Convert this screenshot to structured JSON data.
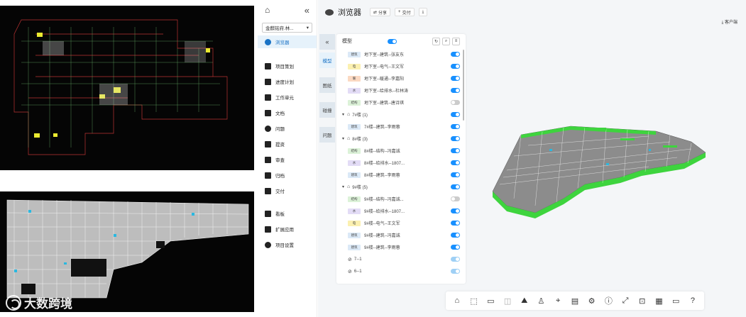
{
  "sidebar": {
    "project": "金麒铭府.林...",
    "items": [
      {
        "label": "浏览器",
        "icon": "eye-icon"
      },
      {
        "label": "项目策划",
        "icon": "flag-icon"
      },
      {
        "label": "进度计划",
        "icon": "schedule-icon"
      },
      {
        "label": "工作单元",
        "icon": "cube-icon"
      },
      {
        "label": "文档",
        "icon": "folder-icon"
      },
      {
        "label": "问题",
        "icon": "question-icon"
      },
      {
        "label": "提资",
        "icon": "file-icon"
      },
      {
        "label": "审查",
        "icon": "review-icon"
      },
      {
        "label": "归档",
        "icon": "archive-icon"
      },
      {
        "label": "交付",
        "icon": "delivery-icon"
      },
      {
        "label": "看板",
        "icon": "board-icon"
      },
      {
        "label": "扩展应用",
        "icon": "apps-icon"
      },
      {
        "label": "项目设置",
        "icon": "gear-icon"
      }
    ]
  },
  "header": {
    "title": "浏览器",
    "share": "分享",
    "deliver": "交付",
    "client": "客户端"
  },
  "tabs": [
    "模型",
    "图纸",
    "碰撞",
    "问题"
  ],
  "panel": {
    "label": "模型"
  },
  "rows": [
    {
      "type": "item",
      "tag": "建筑",
      "tagColor": "#dbe9f7",
      "text": "地下室--建筑--张友东",
      "on": true
    },
    {
      "type": "item",
      "tag": "电",
      "tagColor": "#fbf0b0",
      "text": "地下室--电气--王文军",
      "on": true
    },
    {
      "type": "item",
      "tag": "暖",
      "tagColor": "#fbd9c2",
      "text": "地下室--暖通--李嘉阳",
      "on": true
    },
    {
      "type": "item",
      "tag": "水",
      "tagColor": "#e3dcf6",
      "text": "地下室--给排水--杜林涛",
      "on": true
    },
    {
      "type": "item",
      "tag": "结构",
      "tagColor": "#dcf2d8",
      "text": "地下室--建筑--唐诗琪",
      "on": false
    },
    {
      "type": "group",
      "text": "7#楼 (1)",
      "on": true
    },
    {
      "type": "item",
      "tag": "建筑",
      "tagColor": "#dbe9f7",
      "text": "7#楼--建筑--李雨蓉",
      "on": true
    },
    {
      "type": "group",
      "text": "8#楼 (3)",
      "on": true
    },
    {
      "type": "item",
      "tag": "结构",
      "tagColor": "#dcf2d8",
      "text": "8#楼--结构--冯嘉诚",
      "on": true
    },
    {
      "type": "item",
      "tag": "水",
      "tagColor": "#e3dcf6",
      "text": "8#楼--给排水--1807...",
      "on": true
    },
    {
      "type": "item",
      "tag": "建筑",
      "tagColor": "#dbe9f7",
      "text": "8#楼--建筑--李雨蓉",
      "on": true
    },
    {
      "type": "group",
      "text": "9#楼 (5)",
      "on": true
    },
    {
      "type": "item",
      "tag": "结构",
      "tagColor": "#dcf2d8",
      "text": "9#楼--结构--冯嘉诚...",
      "on": false
    },
    {
      "type": "item",
      "tag": "水",
      "tagColor": "#e3dcf6",
      "text": "9#楼--给排水--1807...",
      "on": true
    },
    {
      "type": "item",
      "tag": "电",
      "tagColor": "#fbf0b0",
      "text": "9#楼--电气--王文军",
      "on": true
    },
    {
      "type": "item",
      "tag": "建筑",
      "tagColor": "#dbe9f7",
      "text": "9#楼--建筑--冯嘉诚",
      "on": true
    },
    {
      "type": "item",
      "tag": "建筑",
      "tagColor": "#dbe9f7",
      "text": "9#楼--建筑--李雨蓉",
      "on": true
    },
    {
      "type": "link",
      "text": "7--1",
      "on": true
    },
    {
      "type": "link",
      "text": "6--1",
      "on": true
    }
  ],
  "toolbar": [
    "home-icon",
    "box-select-icon",
    "measure-icon",
    "section-icon",
    "roaming-icon",
    "person-icon",
    "location-icon",
    "document-icon",
    "gear-icon",
    "info-icon",
    "fullscreen-icon",
    "folder-icon",
    "grid-icon",
    "message-icon",
    "help-icon"
  ],
  "watermark": "大数跨境",
  "colors": {
    "accent": "#1890ff",
    "modelGreen": "#3ed43e"
  }
}
